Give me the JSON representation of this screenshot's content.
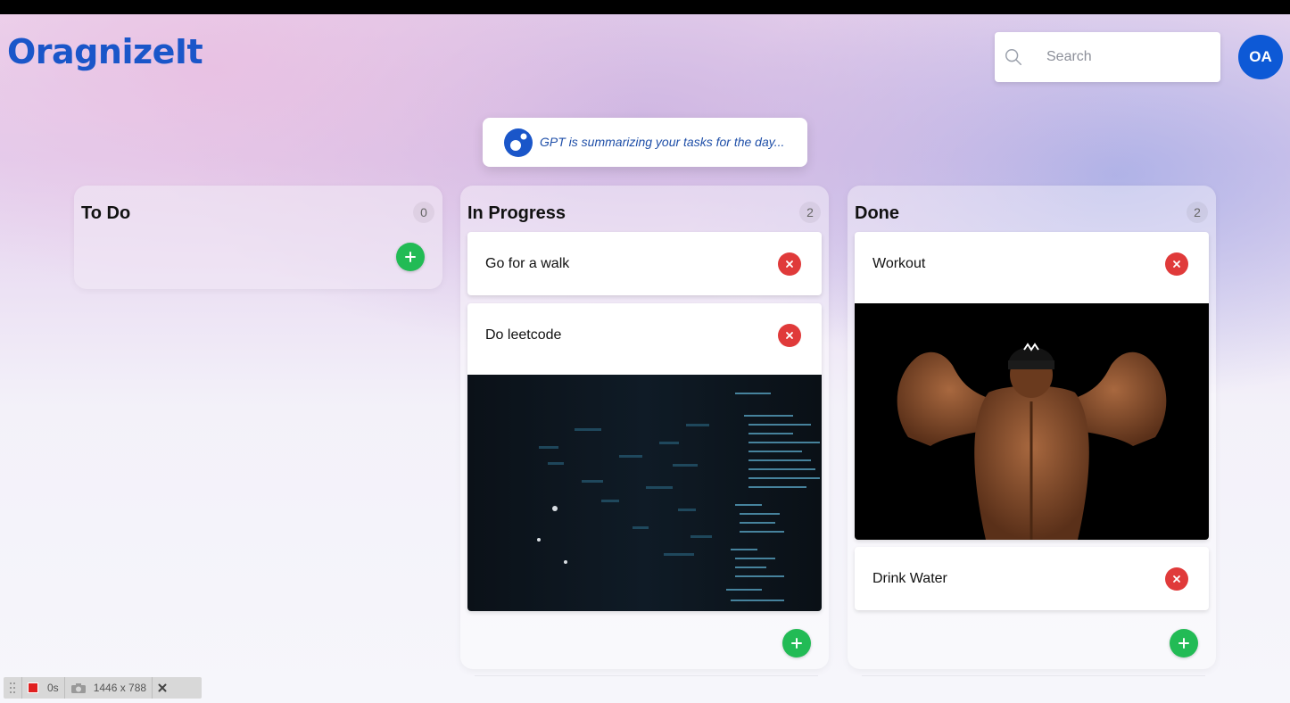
{
  "app": {
    "logo_text": "OragnizeIt"
  },
  "search": {
    "placeholder": "Search",
    "icon": "search-icon"
  },
  "user": {
    "initials": "OA"
  },
  "banner": {
    "text": "GPT is summarizing your tasks for the day...",
    "icon": "gpt-logo-icon"
  },
  "columns": [
    {
      "title": "To Do",
      "count": "0",
      "cards": []
    },
    {
      "title": "In Progress",
      "count": "2",
      "cards": [
        {
          "title": "Go for a walk",
          "image": null
        },
        {
          "title": "Do leetcode",
          "image": "code-screen-image"
        }
      ]
    },
    {
      "title": "Done",
      "count": "2",
      "cards": [
        {
          "title": "Workout",
          "image": "bodybuilder-image"
        },
        {
          "title": "Drink Water",
          "image": null
        }
      ]
    }
  ],
  "devtools": {
    "time": "0s",
    "dimensions": "1446 x 788"
  },
  "colors": {
    "brand": "#1a56c9",
    "avatar": "#0d59d6",
    "add": "#22bb55",
    "delete": "#e03a3a"
  }
}
